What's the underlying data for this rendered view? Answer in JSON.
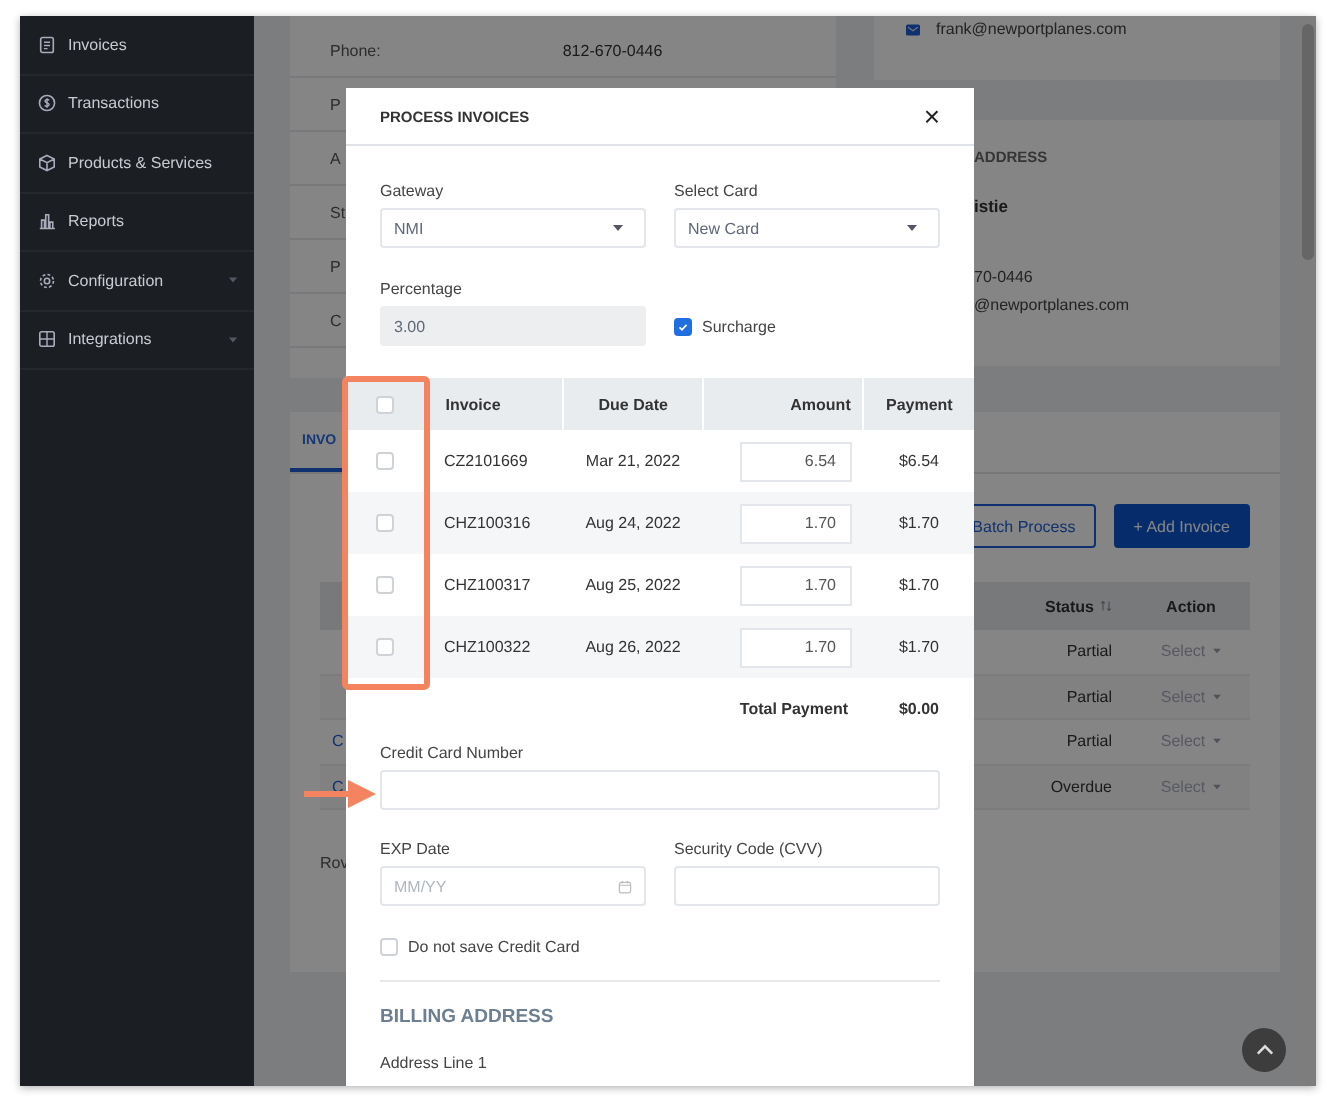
{
  "sidebar": {
    "items": [
      {
        "label": "Invoices",
        "has_submenu": false
      },
      {
        "label": "Transactions",
        "has_submenu": false
      },
      {
        "label": "Products & Services",
        "has_submenu": false
      },
      {
        "label": "Reports",
        "has_submenu": false
      },
      {
        "label": "Configuration",
        "has_submenu": true
      },
      {
        "label": "Integrations",
        "has_submenu": true
      }
    ]
  },
  "contact_rows": [
    {
      "label": "Phone:",
      "value": "812-670-0446"
    },
    {
      "label": "P"
    },
    {
      "label": "A"
    },
    {
      "label": "St"
    },
    {
      "label": "P"
    },
    {
      "label": "C"
    }
  ],
  "email_card": {
    "email": "frank@newportplanes.com"
  },
  "address_card": {
    "heading": "ADDRESS",
    "name": "istie",
    "phone": "70-0446",
    "email": "@newportplanes.com"
  },
  "invoices_panel": {
    "tab": "INVO",
    "buttons": [
      {
        "label": "Batch Process",
        "kind": "outline"
      },
      {
        "label": "+ Add Invoice",
        "kind": "primary"
      }
    ],
    "columns": [
      "Status",
      "Action"
    ],
    "rows": [
      {
        "status": "Partial",
        "action": "Select"
      },
      {
        "status": "Partial",
        "action": "Select"
      },
      {
        "invoice": "C",
        "status": "Partial",
        "action": "Select"
      },
      {
        "invoice": "C",
        "status": "Overdue",
        "action": "Select"
      }
    ],
    "footer": "Rov"
  },
  "modal": {
    "title": "PROCESS INVOICES",
    "close": "×",
    "gateway": {
      "label": "Gateway",
      "value": "NMI"
    },
    "select_card": {
      "label": "Select Card",
      "value": "New Card"
    },
    "percentage": {
      "label": "Percentage",
      "value": "3.00"
    },
    "surcharge": {
      "label": "Surcharge",
      "checked": true
    },
    "table": {
      "select_all_checked": false,
      "columns": [
        "Invoice",
        "Due Date",
        "Amount",
        "Payment"
      ],
      "rows": [
        {
          "checked": false,
          "invoice": "CZ2101669",
          "due_date": "Mar 21, 2022",
          "amount": "6.54",
          "payment": "$6.54"
        },
        {
          "checked": false,
          "invoice": "CHZ100316",
          "due_date": "Aug 24, 2022",
          "amount": "1.70",
          "payment": "$1.70"
        },
        {
          "checked": false,
          "invoice": "CHZ100317",
          "due_date": "Aug 25, 2022",
          "amount": "1.70",
          "payment": "$1.70"
        },
        {
          "checked": false,
          "invoice": "CHZ100322",
          "due_date": "Aug 26, 2022",
          "amount": "1.70",
          "payment": "$1.70"
        }
      ]
    },
    "total": {
      "label": "Total Payment",
      "value": "$0.00"
    },
    "card_number": {
      "label": "Credit Card Number"
    },
    "exp_date": {
      "label": "EXP Date",
      "placeholder": "MM/YY"
    },
    "cvv": {
      "label": "Security Code (CVV)"
    },
    "save_card": {
      "label": "Do not save Credit Card",
      "checked": false
    },
    "billing_heading": "BILLING ADDRESS",
    "address_line_1": {
      "label": "Address Line 1"
    }
  }
}
